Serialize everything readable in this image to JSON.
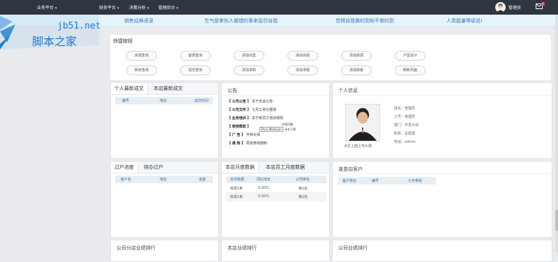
{
  "topbar": {
    "menus": [
      "业务平台",
      "财务平台",
      "决策分析",
      "管理后台"
    ],
    "user": "管理员",
    "mail_count": "1"
  },
  "marquee": [
    "销售经典语录",
    "生气是拿别人做错的事来惩罚自我",
    "觉得自我做的到和不做的到",
    "人类能量等级说!"
  ],
  "watermark": {
    "line1": "jb51.net",
    "line2": "脚本之家"
  },
  "quick": {
    "title": "快捷按钮",
    "row1": [
      "房源查询",
      "客源查询",
      "添加出售",
      "添加出租",
      "添加房源",
      "户型设计"
    ],
    "row2": [
      "新房查询",
      "成交查询",
      "添加求购",
      "添加求租",
      "添加房客",
      "刷新页面"
    ]
  },
  "latest": {
    "tabs": [
      "个人最新成交",
      "本店最新成交"
    ],
    "headers": [
      "编号",
      "地址",
      "成交时间"
    ]
  },
  "notice": {
    "title": "公告",
    "items": [
      {
        "tag": "【 公司公告 】",
        "text": "关于年会公告"
      },
      {
        "tag": "【 公司文件 】",
        "text": "七月工资分报单"
      },
      {
        "tag": "【 业务培训 】",
        "text": "关于新员工培训规则"
      },
      {
        "tag": "【 使用帮助 】",
        "text": ""
      },
      {
        "tag": "【 广 告 】",
        "text": "开林大师"
      },
      {
        "tag": "【 通 知 】",
        "text": "周道参观通知"
      }
    ],
    "tooltip1": "Zhou Wekovan",
    "tooltip2": "环保问题",
    "tooltip3": "动长下载"
  },
  "personal": {
    "title": "个人信息",
    "fields": [
      {
        "label": "姓名：",
        "value": "管理员"
      },
      {
        "label": "工号：",
        "value": "管理员"
      },
      {
        "label": "部门：",
        "value": "开发大师"
      },
      {
        "label": "职务：",
        "value": "总经理"
      },
      {
        "label": "电话：",
        "value": "admin"
      }
    ],
    "caption": "点击上面上传头像"
  },
  "transfer": {
    "tabs": [
      "过户进度",
      "待办过户"
    ],
    "headers": [
      "客户名",
      "地址",
      "进度"
    ]
  },
  "monthly": {
    "tabs": [
      "本店月度数据",
      "本店员工月度数据"
    ],
    "headers": [
      "本月数据",
      "同比增长",
      "公司排名"
    ],
    "rows": [
      [
        "房源1条",
        "0.00%",
        "第1名"
      ],
      [
        "房源1条",
        "0.00%",
        "第2名"
      ]
    ]
  },
  "intent": {
    "title": "准意向客户",
    "headers": [
      "客户姓名",
      "编号",
      "七天带看"
    ]
  },
  "bottom": [
    "公司分店业绩排行",
    "本店业绩排行",
    "公司业绩排行"
  ],
  "colors": {
    "topbar": "#2f3640",
    "marquee_bg": "#e6f4fa",
    "marquee_text": "#3a7ab3",
    "watermark": "#1e7ad1"
  }
}
